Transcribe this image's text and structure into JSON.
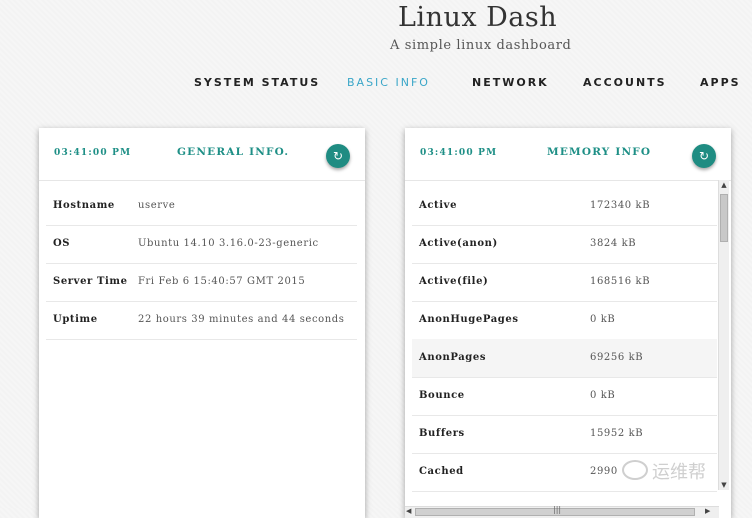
{
  "header": {
    "title": "Linux Dash",
    "subtitle": "A simple linux dashboard"
  },
  "nav": {
    "items": [
      {
        "label": "SYSTEM STATUS",
        "active": false
      },
      {
        "label": "BASIC INFO",
        "active": true
      },
      {
        "label": "NETWORK",
        "active": false
      },
      {
        "label": "ACCOUNTS",
        "active": false
      },
      {
        "label": "APPS",
        "active": false
      }
    ]
  },
  "general": {
    "time": "03:41:00 PM",
    "title": "GENERAL INFO.",
    "refresh_icon": "refresh-icon",
    "rows": [
      {
        "key": "Hostname",
        "value": "userve"
      },
      {
        "key": "OS",
        "value": "Ubuntu 14.10 3.16.0-23-generic"
      },
      {
        "key": "Server Time",
        "value": "Fri Feb 6 15:40:57 GMT 2015"
      },
      {
        "key": "Uptime",
        "value": "22 hours 39 minutes and 44 seconds"
      }
    ]
  },
  "memory": {
    "time": "03:41:00 PM",
    "title": "MEMORY INFO",
    "refresh_icon": "refresh-icon",
    "rows": [
      {
        "key": "Active",
        "value": "172340 kB"
      },
      {
        "key": "Active(anon)",
        "value": "3824 kB"
      },
      {
        "key": "Active(file)",
        "value": "168516 kB"
      },
      {
        "key": "AnonHugePages",
        "value": "0 kB"
      },
      {
        "key": "AnonPages",
        "value": "69256 kB"
      },
      {
        "key": "Bounce",
        "value": "0 kB"
      },
      {
        "key": "Buffers",
        "value": "15952 kB"
      },
      {
        "key": "Cached",
        "value": "2990"
      }
    ]
  },
  "watermark": {
    "text": "运维帮"
  },
  "colors": {
    "accent": "#1e8f86",
    "nav_active": "#3aa6c8"
  }
}
